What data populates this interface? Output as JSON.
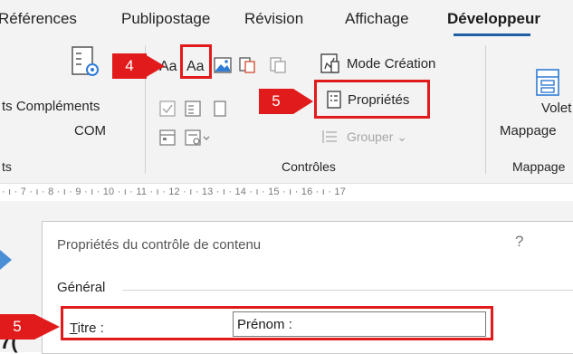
{
  "tabs": [
    {
      "label": "Références",
      "active": false
    },
    {
      "label": "Publipostage",
      "active": false
    },
    {
      "label": "Révision",
      "active": false
    },
    {
      "label": "Affichage",
      "active": false
    },
    {
      "label": "Développeur",
      "active": true
    }
  ],
  "ribbon": {
    "left_group_fragment": "ts",
    "addins": {
      "label_line1": "Compléments",
      "label_prefix": "ts",
      "label_line2": "COM"
    },
    "controls": {
      "text_control_rich": "Aa",
      "text_control_plain": "Aa",
      "design_mode_label": "Mode Création",
      "properties_label": "Propriétés",
      "group_label": "Grouper",
      "group_name": "Contrôles"
    },
    "mapping": {
      "pane_label_line1": "Volet",
      "pane_label_line2": "Mappage",
      "group_name": "Mappage"
    }
  },
  "callouts": [
    {
      "number": "4",
      "color": "#e11b1b"
    },
    {
      "number": "5",
      "color": "#e11b1b"
    },
    {
      "number": "5",
      "color": "#e11b1b"
    }
  ],
  "ruler_text": "· ı · 7 · ı · 8 · ı · 9 · ı · 10 · ı · 11 · ı · 12 · ı · 13 · ı · 14 · ı · 15 · ı · 16 · ı · 17",
  "dialog": {
    "title": "Propriétés du contrôle de contenu",
    "help": "?",
    "section": "Général",
    "title_field_label": "Titre :",
    "title_field_value": "Prénom :"
  },
  "doc_fragment": "7("
}
